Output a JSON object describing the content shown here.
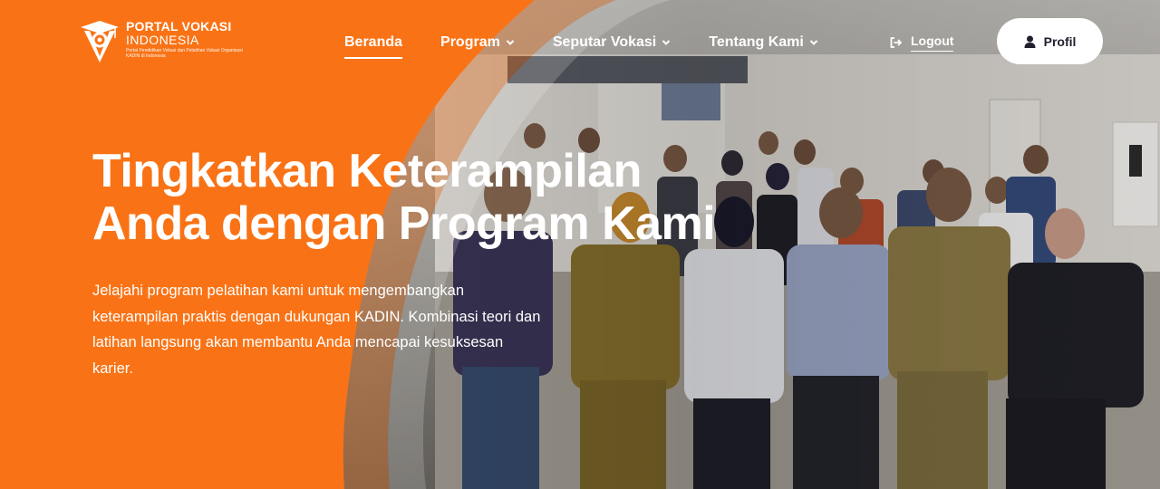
{
  "brand": {
    "title": "PORTAL VOKASI",
    "subtitle": "INDONESIA",
    "tagline": "Portal Pendidikan Vokasi dan Pelatihan Vokasi Organisasi KADIN di Indonesia"
  },
  "nav": {
    "items": [
      {
        "label": "Beranda",
        "active": true,
        "dropdown": false
      },
      {
        "label": "Program",
        "active": false,
        "dropdown": true
      },
      {
        "label": "Seputar Vokasi",
        "active": false,
        "dropdown": true
      },
      {
        "label": "Tentang Kami",
        "active": false,
        "dropdown": true
      }
    ],
    "logout_label": "Logout",
    "profile_label": "Profil"
  },
  "hero": {
    "headline_line1": "Tingkatkan Keterampilan",
    "headline_line2": "Anda dengan Program Kami",
    "description": "Jelajahi program pelatihan kami untuk mengembangkan keterampilan praktis dengan dukungan KADIN. Kombinasi teori dan latihan langsung akan membantu Anda mencapai kesuksesan karier."
  },
  "colors": {
    "accent": "#f97316",
    "button_bg": "#ffffff",
    "button_text": "#1f1f2e"
  },
  "icons": {
    "logout": "logout-icon",
    "profile": "user-icon",
    "dropdown": "chevron-down-icon"
  }
}
